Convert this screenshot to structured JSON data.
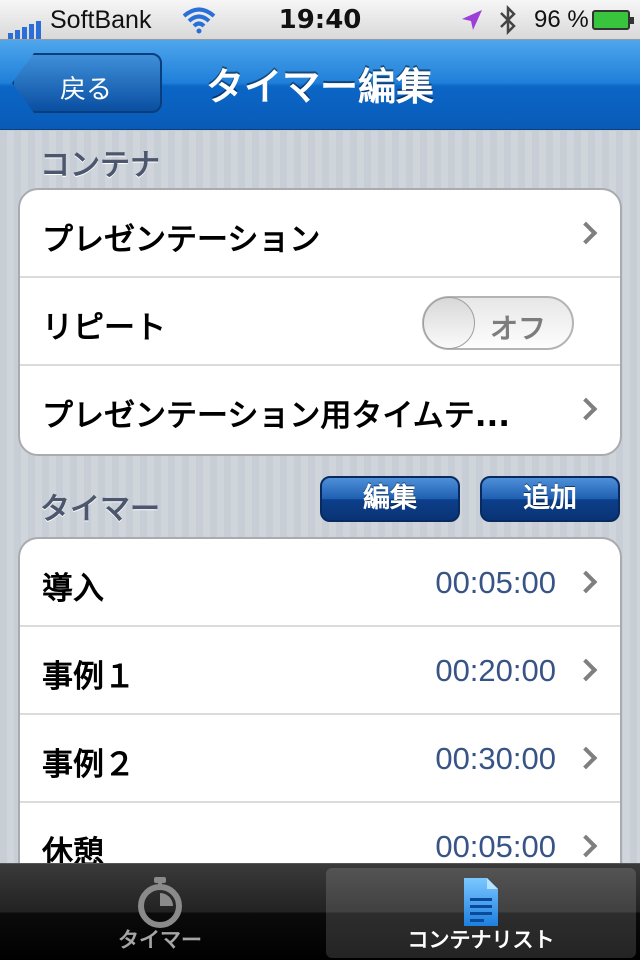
{
  "status_bar": {
    "carrier": "SoftBank",
    "time": "19:40",
    "battery_percent": "96 %",
    "icons": [
      "signal-icon",
      "wifi-icon",
      "location-icon",
      "bluetooth-icon",
      "battery-icon"
    ]
  },
  "nav": {
    "back_label": "戻る",
    "title": "タイマー編集"
  },
  "container_section": {
    "header": "コンテナ",
    "rows": {
      "presentation": "プレゼンテーション",
      "repeat": "リピート",
      "repeat_toggle": "オフ",
      "time_template": "プレゼンテーション用タイムテ..."
    }
  },
  "timer_section": {
    "header": "タイマー",
    "edit_label": "編集",
    "add_label": "追加",
    "items": [
      {
        "name": "導入",
        "time": "00:05:00"
      },
      {
        "name": "事例１",
        "time": "00:20:00"
      },
      {
        "name": "事例２",
        "time": "00:30:00"
      },
      {
        "name": "休憩",
        "time": "00:05:00"
      }
    ]
  },
  "tabbar": {
    "tabs": [
      {
        "label": "タイマー",
        "icon": "stopwatch-icon"
      },
      {
        "label": "コンテナリスト",
        "icon": "document-icon"
      }
    ]
  },
  "colors": {
    "nav_blue": "#1f7fd9",
    "value_blue": "#385487",
    "section_label": "#4c566c"
  }
}
